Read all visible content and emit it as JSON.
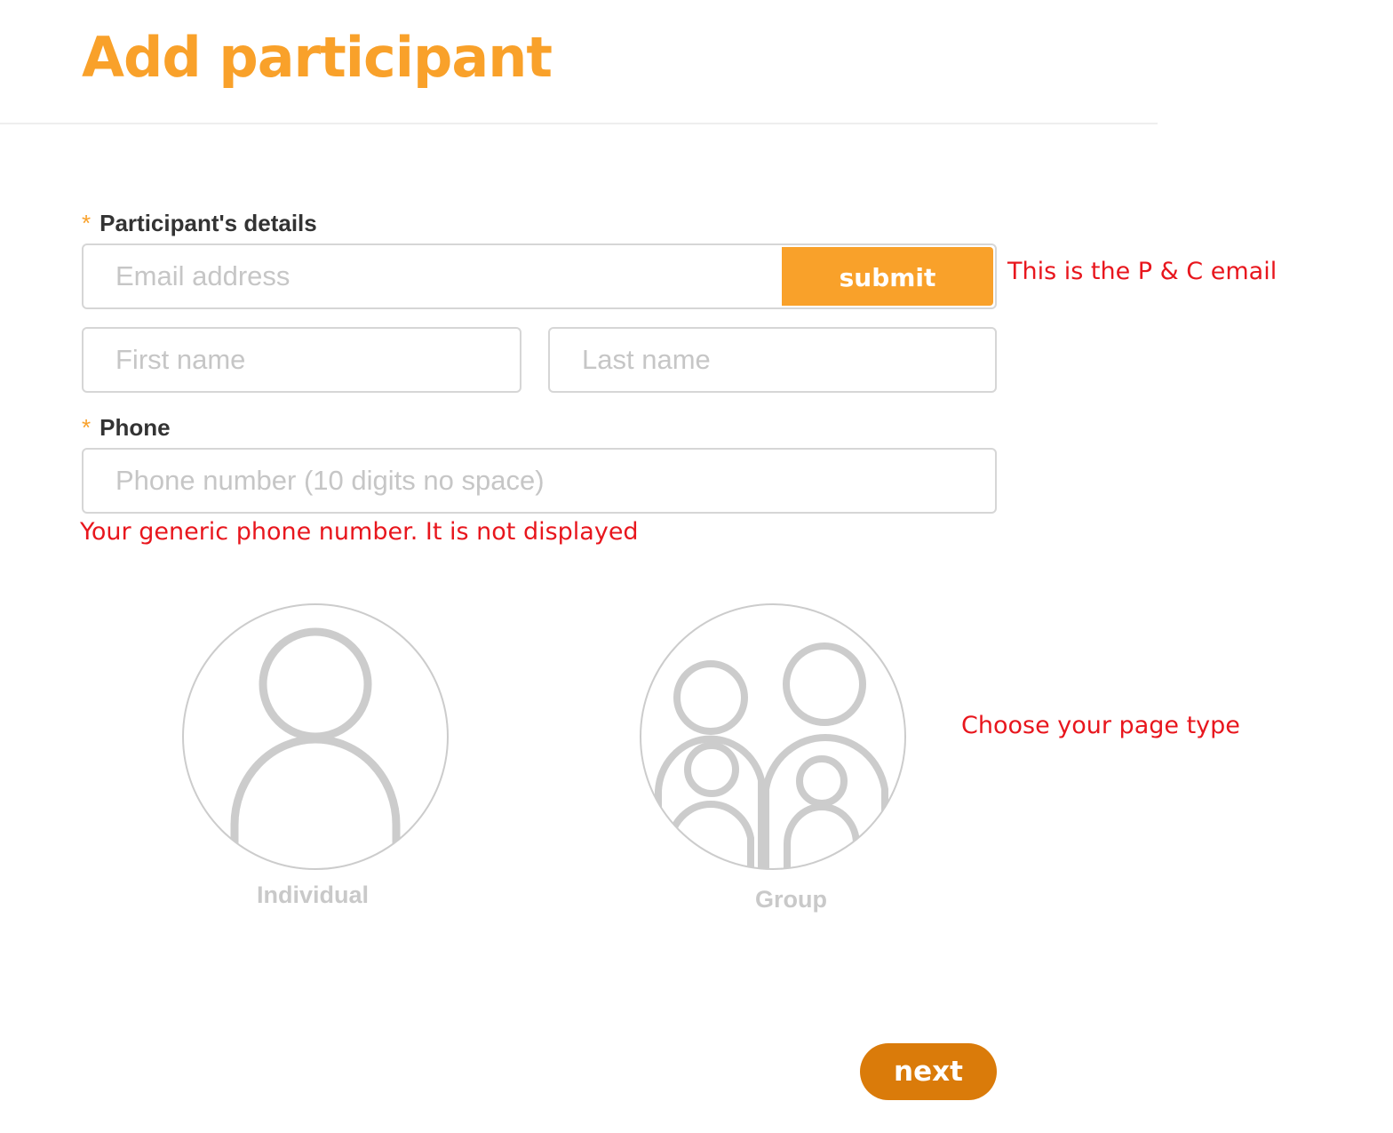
{
  "header": {
    "title": "Add participant"
  },
  "participant_details": {
    "required_marker": "*",
    "label": "Participant's details",
    "email_placeholder": "Email address",
    "email_value": "",
    "submit_label": "submit",
    "first_name_placeholder": "First name",
    "first_name_value": "",
    "last_name_placeholder": "Last name",
    "last_name_value": ""
  },
  "phone": {
    "required_marker": "*",
    "label": "Phone",
    "placeholder": "Phone number (10 digits no space)",
    "value": ""
  },
  "annotations": {
    "email_note": "This is the P & C email",
    "phone_note": "Your generic phone number. It is not displayed",
    "page_type_note": "Choose your page type"
  },
  "page_type": {
    "options": [
      {
        "label": "Individual",
        "icon": "person-icon"
      },
      {
        "label": "Group",
        "icon": "group-icon"
      }
    ]
  },
  "footer": {
    "next_label": "next"
  },
  "colors": {
    "brand_orange": "#f9a12a",
    "next_button": "#da7b0a",
    "annotation_red": "#e8161d",
    "icon_gray": "#cccccc"
  }
}
